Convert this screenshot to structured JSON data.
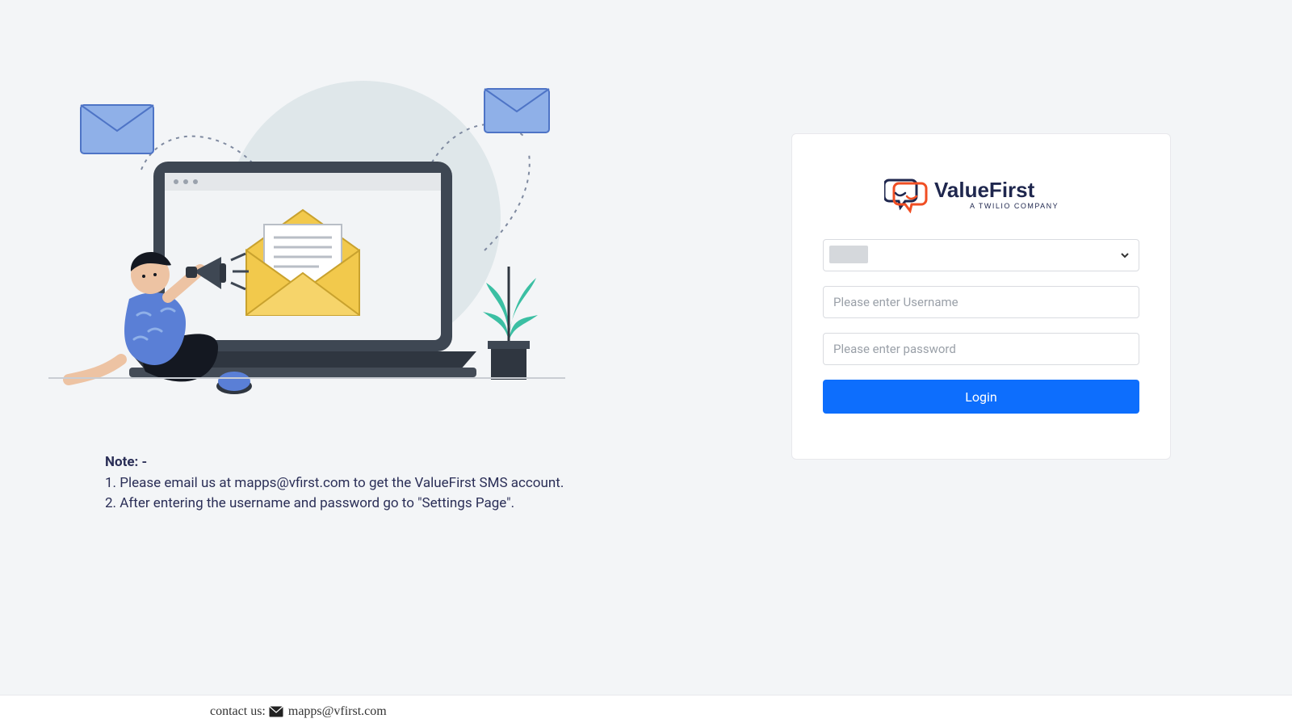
{
  "brand": {
    "name": "ValueFirst",
    "tagline": "A TWILIO COMPANY"
  },
  "login": {
    "select_value": "",
    "username_value": "",
    "username_placeholder": "Please enter Username",
    "password_value": "",
    "password_placeholder": "Please enter password",
    "submit_label": "Login"
  },
  "note": {
    "title": "Note: -",
    "line1": "1. Please email us at mapps@vfirst.com to get the ValueFirst SMS account.",
    "line2": "2. After entering the username and password go to \"Settings Page\"."
  },
  "footer": {
    "label": "contact us:",
    "email": "mapps@vfirst.com"
  },
  "colors": {
    "accent": "#0d6efd",
    "bg": "#f3f5f7",
    "text": "#2b2f57",
    "brand_orange": "#f04e23",
    "brand_navy": "#1f274e"
  }
}
